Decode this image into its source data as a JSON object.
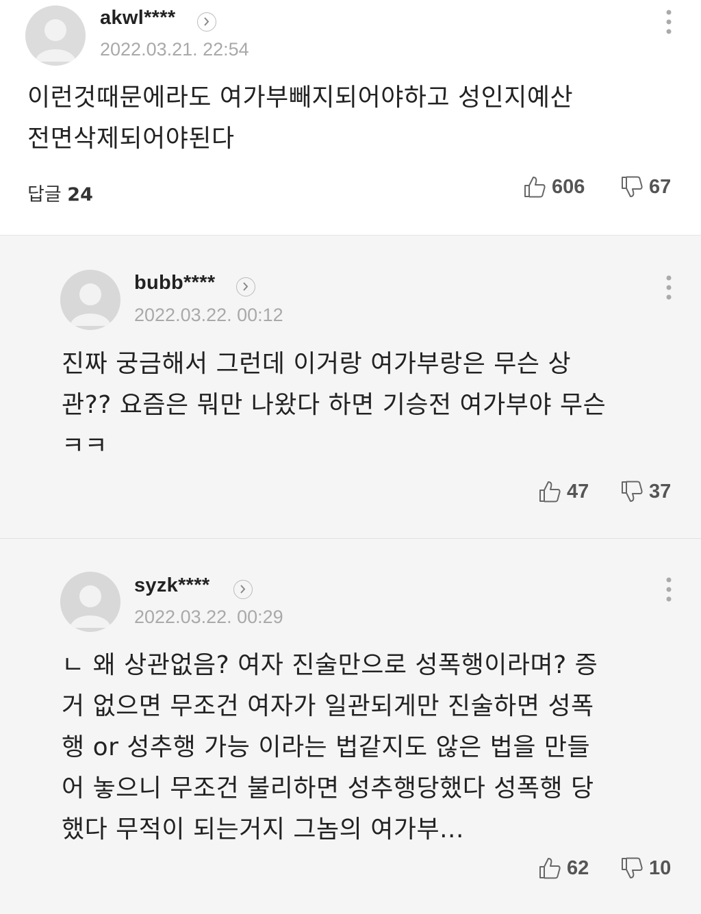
{
  "comments": [
    {
      "username": "akwl****",
      "date": "2022.03.21. 22:54",
      "text": "이런것때문에라도 여가부빼지되어야하고 성인지예산\n전면삭제되어야된다",
      "reply_label": "답글",
      "reply_count": "24",
      "likes": "606",
      "dislikes": "67"
    }
  ],
  "replies": [
    {
      "username": "bubb****",
      "date": "2022.03.22. 00:12",
      "text": "진짜 궁금해서 그런데 이거랑 여가부랑은 무슨 상\n관?? 요즘은 뭐만 나왔다 하면 기승전 여가부야 무슨\nㅋㅋ",
      "likes": "47",
      "dislikes": "37"
    },
    {
      "username": "syzk****",
      "date": "2022.03.22. 00:29",
      "text": "ㄴ 왜 상관없음? 여자 진술만으로 성폭행이라며? 증\n거 없으면 무조건 여자가 일관되게만 진술하면 성폭\n행 or 성추행 가능 이라는 법같지도 않은 법을 만들\n어 놓으니 무조건 불리하면 성추행당했다 성폭행 당\n했다 무적이 되는거지 그놈의 여가부...",
      "likes": "62",
      "dislikes": "10"
    }
  ],
  "icons": {
    "avatar": "default-avatar-icon",
    "profile_link": "chevron-right-icon",
    "more": "more-vertical-icon",
    "like": "thumbs-up-icon",
    "dislike": "thumbs-down-icon"
  }
}
